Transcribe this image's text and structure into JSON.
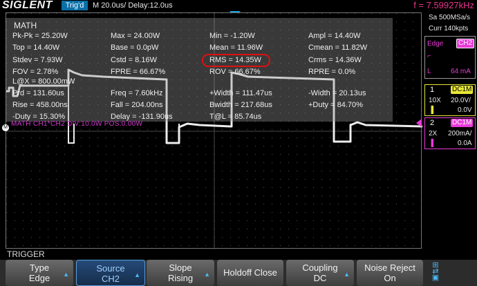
{
  "header": {
    "brand": "SIGLENT",
    "trigger_status": "Trig'd",
    "timebase": "M 20.0us/  Delay:12.0us",
    "frequency": "f = 7.59927kHz"
  },
  "measurements": {
    "title": "MATH",
    "rows": [
      [
        "Pk-Pk = 25.20W",
        "Max = 24.00W",
        "Min = -1.20W",
        "Ampl = 14.40W"
      ],
      [
        "Top = 14.40W",
        "Base = 0.0pW",
        "Mean = 11.96W",
        "Cmean = 11.82W"
      ],
      [
        "Stdev = 7.93W",
        "Cstd = 8.16W",
        "RMS = 14.35W",
        "Crms = 14.36W"
      ],
      [
        "FOV = 2.78%",
        "FPRE = 66.67%",
        "ROV = 66.67%",
        "RPRE = 0.0%"
      ],
      [
        "L@X = 800.00mW",
        "",
        "",
        ""
      ],
      [
        "Prd = 131.60us",
        "Freq = 7.60kHz",
        "+Width = 111.47us",
        "-Width = 20.13us"
      ],
      [
        "Rise = 458.00ns",
        "Fall = 204.00ns",
        "Bwidth = 217.68us",
        "+Duty = 84.70%"
      ],
      [
        "-Duty = 15.30%",
        "Delay = -131.90us",
        "T@L = 85.74us",
        ""
      ]
    ],
    "math_label": "MATH  CH1*CH2  DIV:10.0W  POS:0.00W"
  },
  "right_panel": {
    "sample_rate": "Sa 500MSa/s",
    "memory": "Curr 140kpts",
    "trigger_type": "Edge",
    "trigger_source": "CH2",
    "trigger_slope_label": "L",
    "trigger_level": "64 mA",
    "ch1": {
      "num": "1",
      "coupling": "DC1M",
      "probe": "10X",
      "scale": "20.0V/",
      "offset": "0.0V",
      "color": "#e8e838"
    },
    "ch2": {
      "num": "2",
      "coupling": "DC1M",
      "probe": "2X",
      "scale": "200mA/",
      "offset": "0.0A",
      "color": "#e83ad8"
    }
  },
  "menu": {
    "title": "TRIGGER",
    "buttons": [
      {
        "line1": "Type",
        "line2": "Edge"
      },
      {
        "line1": "Source",
        "line2": "CH2"
      },
      {
        "line1": "Slope",
        "line2": "Rising"
      },
      {
        "line1": "Holdoff Close",
        "line2": ""
      },
      {
        "line1": "Coupling",
        "line2": "DC"
      },
      {
        "line1": "Noise Reject",
        "line2": "On"
      }
    ]
  },
  "colors": {
    "accent": "#1e9fe0",
    "math": "#d23ad0",
    "ch1": "#e8e838",
    "ch2": "#e83ad8",
    "highlight_ring": "#e01010"
  }
}
